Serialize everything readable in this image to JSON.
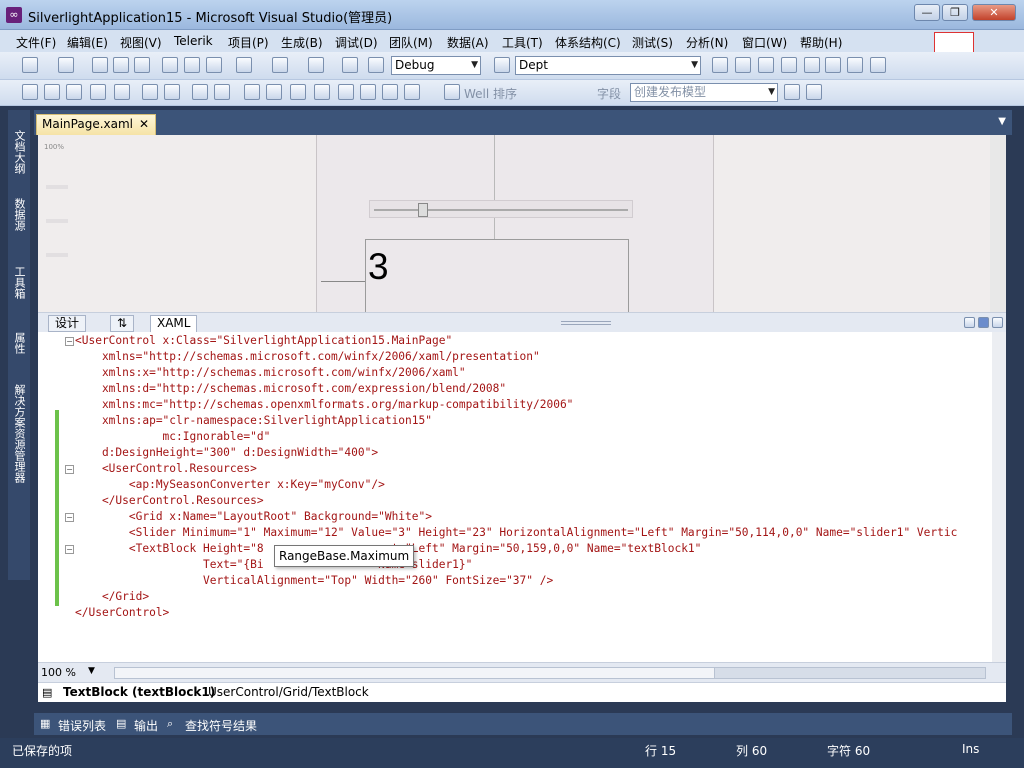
{
  "window": {
    "title": "SilverlightApplication15 - Microsoft Visual Studio(管理员)",
    "minimize": "—",
    "restore": "❐",
    "close": "✕"
  },
  "menu": [
    "文件(F)",
    "编辑(E)",
    "视图(V)",
    "Telerik",
    "项目(P)",
    "生成(B)",
    "调试(D)",
    "团队(M)",
    "数据(A)",
    "工具(T)",
    "体系结构(C)",
    "测试(S)",
    "分析(N)",
    "窗口(W)",
    "帮助(H)"
  ],
  "toolbar": {
    "config": "Debug",
    "find_combo": "Dept",
    "row2_fragment": "Well 排序",
    "row2_label": "字段",
    "row2_combo": "创建发布模型"
  },
  "left_tabs": [
    "文档大纲",
    "数据源",
    "工具箱",
    "属性",
    "解决方案资源管理器"
  ],
  "document": {
    "tab": "MainPage.xaml",
    "tab_close": "✕",
    "designer_zoom": "100%",
    "preview_value": "3"
  },
  "split_tabs": {
    "design": "设计",
    "swap": "⇅",
    "xaml": "XAML"
  },
  "code_lines": [
    "<UserControl x:Class=\"SilverlightApplication15.MainPage\"",
    "    xmlns=\"http://schemas.microsoft.com/winfx/2006/xaml/presentation\"",
    "    xmlns:x=\"http://schemas.microsoft.com/winfx/2006/xaml\"",
    "    xmlns:d=\"http://schemas.microsoft.com/expression/blend/2008\"",
    "    xmlns:mc=\"http://schemas.openxmlformats.org/markup-compatibility/2006\"",
    "    xmlns:ap=\"clr-namespace:SilverlightApplication15\"",
    "             mc:Ignorable=\"d\"",
    "    d:DesignHeight=\"300\" d:DesignWidth=\"400\">",
    "    <UserControl.Resources>",
    "        <ap:MySeasonConverter x:Key=\"myConv\"/>",
    "    </UserControl.Resources>",
    "        <Grid x:Name=\"LayoutRoot\" Background=\"White\">",
    "        <Slider Minimum=\"1\" Maximum=\"12\" Value=\"3\" Height=\"23\" HorizontalAlignment=\"Left\" Margin=\"50,114,0,0\" Name=\"slider1\" Vertic",
    "        <TextBlock Height=\"8                 ent=\"Left\" Margin=\"50,159,0,0\" Name=\"textBlock1\"",
    "                   Text=\"{Bi                 Name=slider1}\"",
    "                   VerticalAlignment=\"Top\" Width=\"260\" FontSize=\"37\" />",
    "    </Grid>",
    "</UserControl>"
  ],
  "tooltip": "RangeBase.Maximum",
  "zoom": "100 %",
  "breadcrumb": {
    "element": "TextBlock (textBlock1)",
    "path": "UserControl/Grid/TextBlock"
  },
  "tool_tabs": [
    "错误列表",
    "输出",
    "查找符号结果"
  ],
  "status": {
    "left": "已保存的项",
    "line": "行 15",
    "col": "列 60",
    "char": "字符 60",
    "mode": "Ins"
  }
}
